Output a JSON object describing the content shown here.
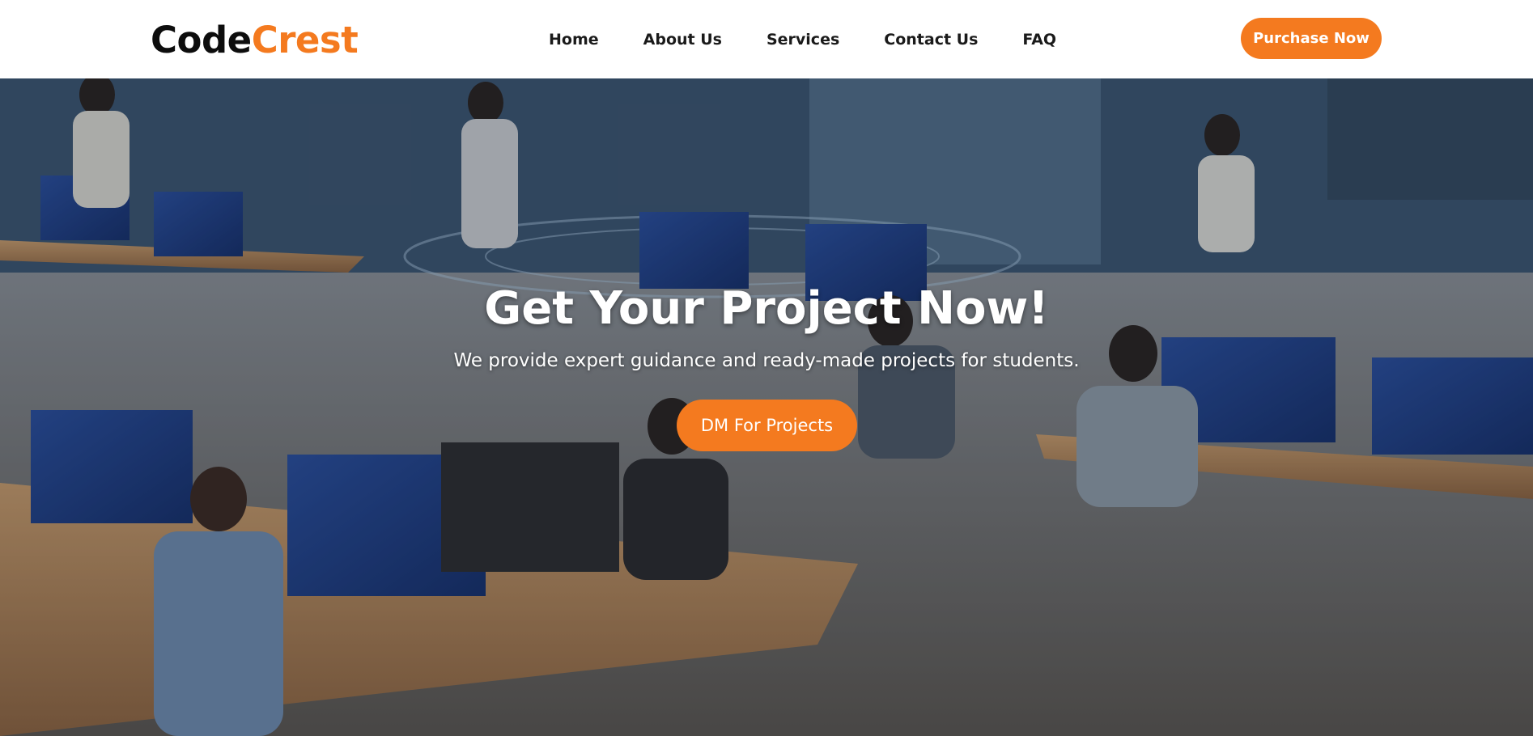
{
  "brand": {
    "logo_part1": "Code",
    "logo_part2": "Crest",
    "accent_color": "#f47a1f"
  },
  "nav": {
    "items": [
      {
        "label": "Home"
      },
      {
        "label": "About Us"
      },
      {
        "label": "Services"
      },
      {
        "label": "Contact Us"
      },
      {
        "label": "FAQ"
      }
    ],
    "purchase_label": "Purchase Now"
  },
  "hero": {
    "title": "Get Your Project Now!",
    "subtitle": "We provide expert guidance and ready-made projects for students.",
    "cta_label": "DM For Projects"
  }
}
